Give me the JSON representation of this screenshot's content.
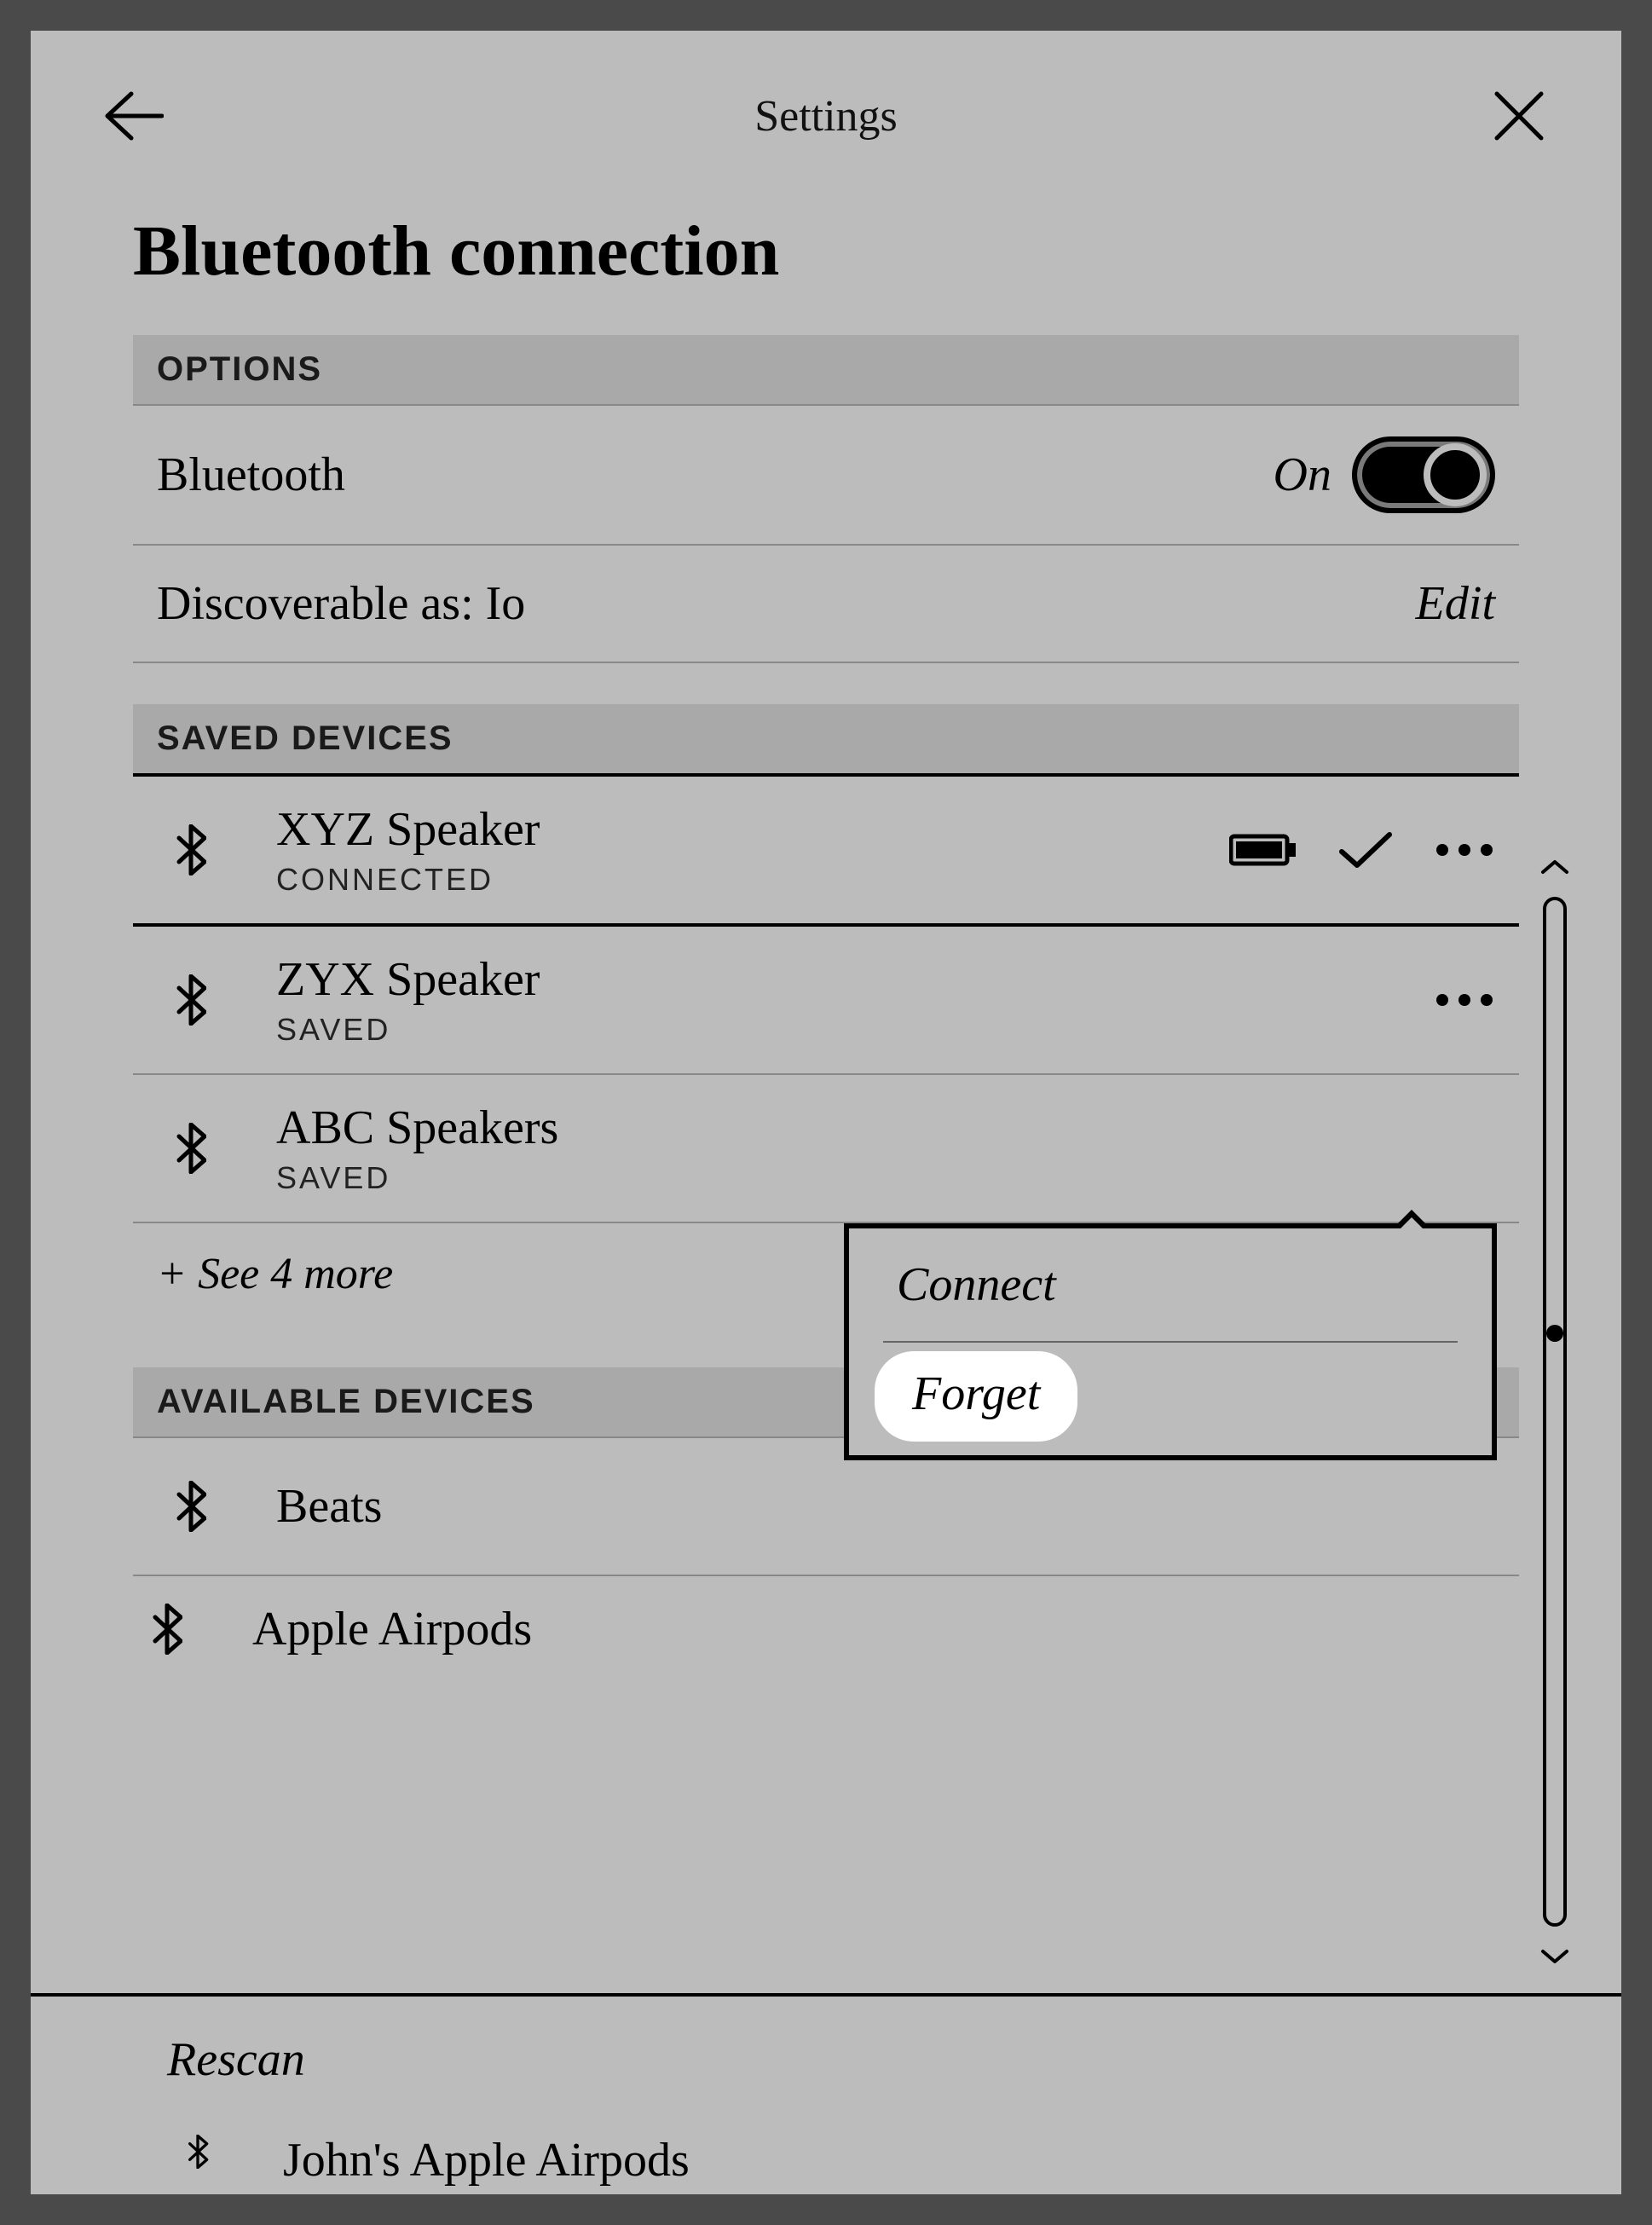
{
  "topbar": {
    "title": "Settings"
  },
  "page": {
    "title": "Bluetooth connection"
  },
  "sections": {
    "options_header": "OPTIONS",
    "saved_header": "SAVED DEVICES",
    "available_header": "AVAILABLE DEVICES"
  },
  "options": {
    "bluetooth_label": "Bluetooth",
    "bluetooth_state": "On",
    "discoverable_label": "Discoverable as: Io",
    "edit": "Edit"
  },
  "saved_devices": [
    {
      "name": "XYZ Speaker",
      "status": "CONNECTED",
      "battery": true,
      "checked": true
    },
    {
      "name": "ZYX Speaker",
      "status": "SAVED"
    },
    {
      "name": "ABC Speakers",
      "status": "SAVED"
    }
  ],
  "see_more": "+ See 4 more",
  "available_devices": [
    {
      "name": "Beats"
    },
    {
      "name": "Apple Airpods"
    },
    {
      "name": "John's Apple Airpods"
    }
  ],
  "popover": {
    "connect": "Connect",
    "forget": "Forget"
  },
  "footer": {
    "rescan": "Rescan"
  }
}
